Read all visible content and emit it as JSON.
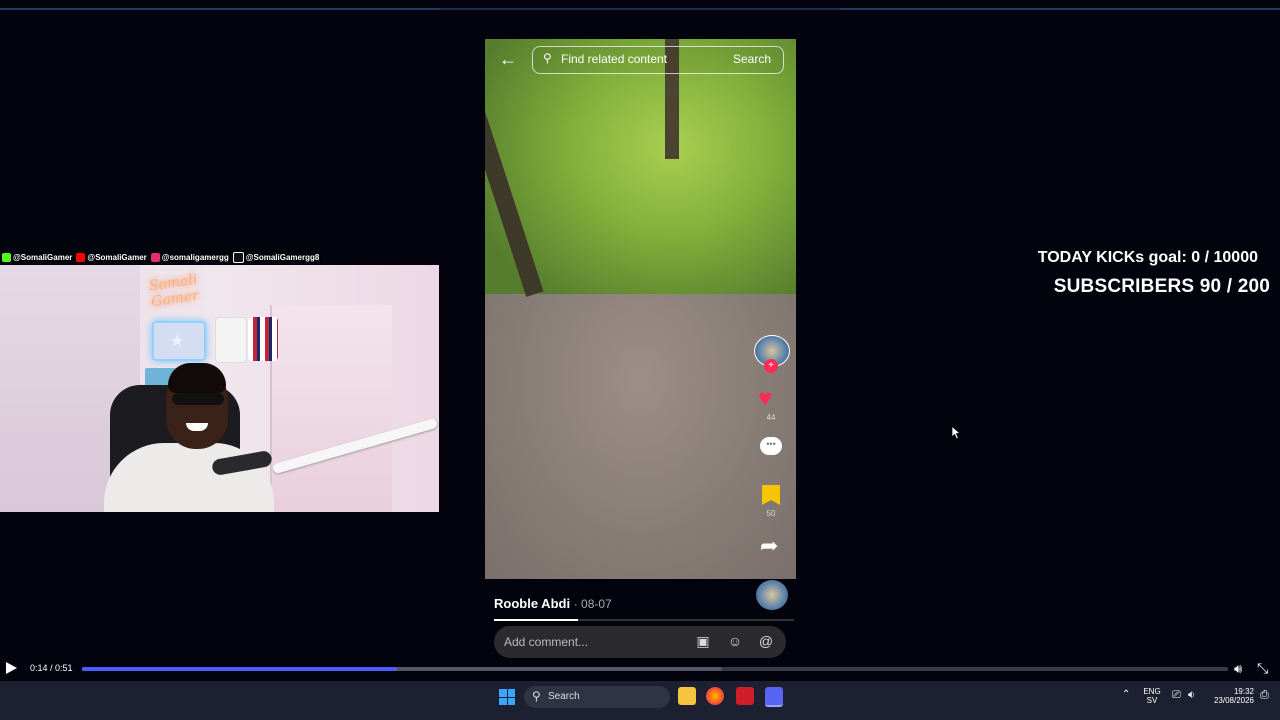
{
  "social": [
    {
      "handle": "@SomaliGamer",
      "color": "#53fc18"
    },
    {
      "handle": "@SomaliGamer",
      "color": "#ff0000"
    },
    {
      "handle": "@somaligamergg",
      "color": "#e1306c"
    },
    {
      "handle": "@SomaliGamergg8",
      "color": "#111111"
    }
  ],
  "webcam": {
    "neon_text_line1": "Somali",
    "neon_text_line2": "Gamer"
  },
  "video": {
    "search_placeholder": "Find related content",
    "search_button": "Search",
    "author": "Rooble Abdi",
    "date": "· 08-07",
    "comment_placeholder": "Add comment...",
    "follow_glyph": "+",
    "like_count": "44",
    "save_count": "50"
  },
  "goals": {
    "kicks": "TODAY KICKs goal: 0 / 10000",
    "subscribers": "SUBSCRIBERS 90 / 200"
  },
  "player": {
    "time": "0:14 / 0:51",
    "progress_fraction": 0.275
  },
  "taskbar": {
    "search_label": "Search",
    "lang_line1": "ENG",
    "lang_line2": "SV",
    "clock_time": "19:32",
    "clock_date": "23/08/2026"
  },
  "colors": {
    "accent": "#4b5cff",
    "like": "#fe2c55",
    "save": "#f7c400"
  }
}
